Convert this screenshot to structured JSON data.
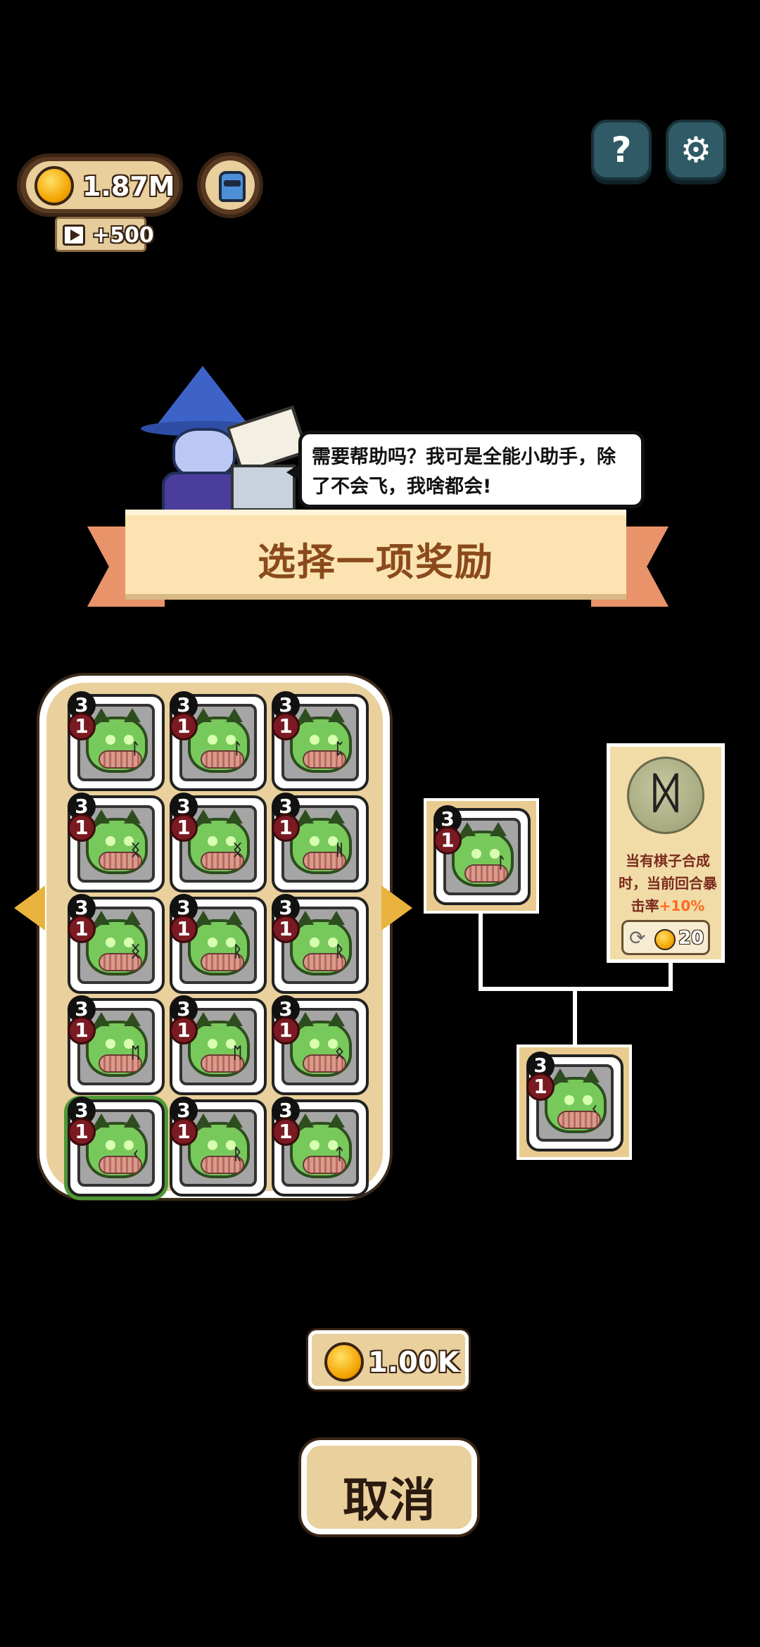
{
  "hud": {
    "coins": "1.87M",
    "ad_reward": "+500"
  },
  "buttons": {
    "help_glyph": "?",
    "settings_glyph": "⚙"
  },
  "icons": {
    "coin": "coin-icon",
    "robot": "robot-icon",
    "play": "play-icon",
    "help": "question-icon",
    "settings": "gear-icon",
    "refresh": "refresh-icon"
  },
  "helper": {
    "speech": "需要帮助吗？我可是全能小助手，除了不会飞，我啥都会!"
  },
  "title": "选择一项奖励",
  "grid": {
    "cards": [
      {
        "level": "3",
        "star": "1",
        "rune": "ᛚ",
        "selected": false
      },
      {
        "level": "3",
        "star": "1",
        "rune": "ᛚ",
        "selected": false
      },
      {
        "level": "3",
        "star": "1",
        "rune": "ᛈ",
        "selected": false
      },
      {
        "level": "3",
        "star": "1",
        "rune": "ᛝ",
        "selected": false
      },
      {
        "level": "3",
        "star": "1",
        "rune": "ᛝ",
        "selected": false
      },
      {
        "level": "3",
        "star": "1",
        "rune": "ᚻ",
        "selected": false
      },
      {
        "level": "3",
        "star": "1",
        "rune": "ᛝ",
        "selected": false
      },
      {
        "level": "3",
        "star": "1",
        "rune": "ᚱ",
        "selected": false
      },
      {
        "level": "3",
        "star": "1",
        "rune": "ᚱ",
        "selected": false
      },
      {
        "level": "3",
        "star": "1",
        "rune": "ᛖ",
        "selected": false
      },
      {
        "level": "3",
        "star": "1",
        "rune": "ᛖ",
        "selected": false
      },
      {
        "level": "3",
        "star": "1",
        "rune": "ᛟ",
        "selected": false
      },
      {
        "level": "3",
        "star": "1",
        "rune": "ᚲ",
        "selected": true
      },
      {
        "level": "3",
        "star": "1",
        "rune": "ᚱ",
        "selected": false
      },
      {
        "level": "3",
        "star": "1",
        "rune": "ᛏ",
        "selected": false
      }
    ]
  },
  "merge": {
    "source": {
      "level": "3",
      "star": "1",
      "rune": "ᛚ"
    },
    "result": {
      "level": "3",
      "star": "1",
      "rune": "ᚲ"
    },
    "info": {
      "rune": "ᛞ",
      "desc_main": "当有棋子合成时，当前回合暴击率",
      "desc_pct": "+10%",
      "cost": "20"
    }
  },
  "price": "1.00K",
  "cancel_label": "取消"
}
